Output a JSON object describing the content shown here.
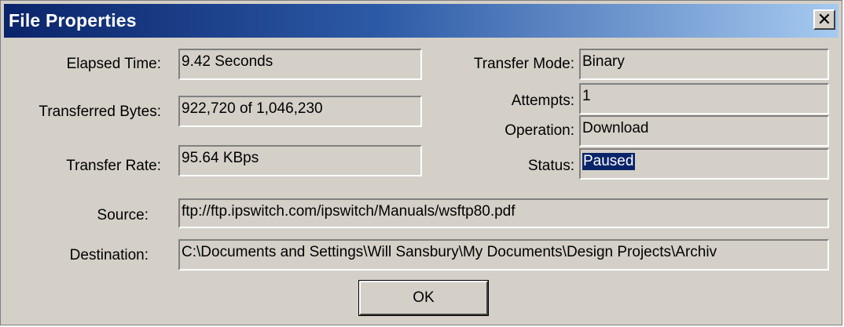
{
  "window": {
    "title": "File Properties",
    "close_glyph": "✕"
  },
  "fields": {
    "elapsed_time": {
      "label": "Elapsed Time:",
      "value": "9.42 Seconds"
    },
    "transferred_bytes": {
      "label": "Transferred Bytes:",
      "value": "922,720 of 1,046,230"
    },
    "transfer_rate": {
      "label": "Transfer Rate:",
      "value": "95.64 KBps"
    },
    "transfer_mode": {
      "label": "Transfer Mode:",
      "value": "Binary"
    },
    "attempts": {
      "label": "Attempts:",
      "value": "1"
    },
    "operation": {
      "label": "Operation:",
      "value": "Download"
    },
    "status": {
      "label": "Status:",
      "value": "Paused"
    },
    "source": {
      "label": "Source:",
      "value": "ftp://ftp.ipswitch.com/ipswitch/Manuals/wsftp80.pdf"
    },
    "destination": {
      "label": "Destination:",
      "value": "C:\\Documents and Settings\\Will Sansbury\\My Documents\\Design Projects\\Archiv"
    }
  },
  "buttons": {
    "ok_label": "OK"
  },
  "icons": {
    "close": "close-icon"
  },
  "colors": {
    "title_gradient_start": "#0a246a",
    "title_gradient_end": "#a6caf0",
    "dialog_face": "#d4d0c8",
    "selection": "#0a246a"
  }
}
